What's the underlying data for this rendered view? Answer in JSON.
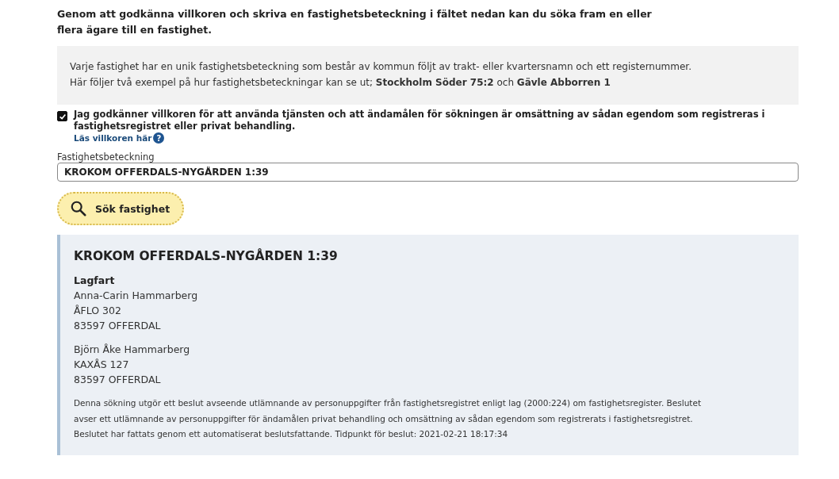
{
  "intro": "Genom att godkänna villkoren och skriva en fastighetsbeteckning i fältet nedan kan du söka fram en eller flera ägare till en fastighet.",
  "info": "Varje fastighet har en unik fastighetsbeteckning som består av kommun följt av trakt- eller kvartersnamn och ett registernummer. Här följer två exempel på hur fastighetsbeteckningar kan se ut; **Stockholm Söder 75:2** och **Gävle Abborren 1**",
  "consent": {
    "label": "Jag godkänner villkoren för att använda tjänsten och att ändamålen för sökningen är omsättning av sådan egendom som registreras i fastighetsregistret eller privat behandling.",
    "checked": true,
    "link": "Läs villkoren här",
    "help_icon": "?"
  },
  "field": {
    "label": "Fastighetsbeteckning",
    "value": "KROKOM OFFERDALS-NYGÅRDEN 1:39"
  },
  "search_button": "Sök fastighet",
  "result": {
    "title": "KROKOM OFFERDALS-NYGÅRDEN 1:39",
    "section": "Lagfart",
    "owners": [
      {
        "lines": [
          "Anna-Carin Hammarberg",
          "ÅFLO 302",
          "83597 OFFERDAL"
        ]
      },
      {
        "lines": [
          "Björn Åke Hammarberg",
          "KAXÅS 127",
          "83597 OFFERDAL"
        ]
      }
    ],
    "notice": "Denna sökning utgör ett beslut avseende utlämnande av personuppgifter från fastighetsregistret enligt lag (2000:224) om fastighetsregister. Beslutet avser ett utlämnande av personuppgifter för ändamålen privat behandling och omsättning av sådan egendom som registrerats i fastighetsregistret. Beslutet har fattats genom ett automatiserat beslutsfattande. Tidpunkt för beslut: 2021-02-21 18:17:34"
  }
}
